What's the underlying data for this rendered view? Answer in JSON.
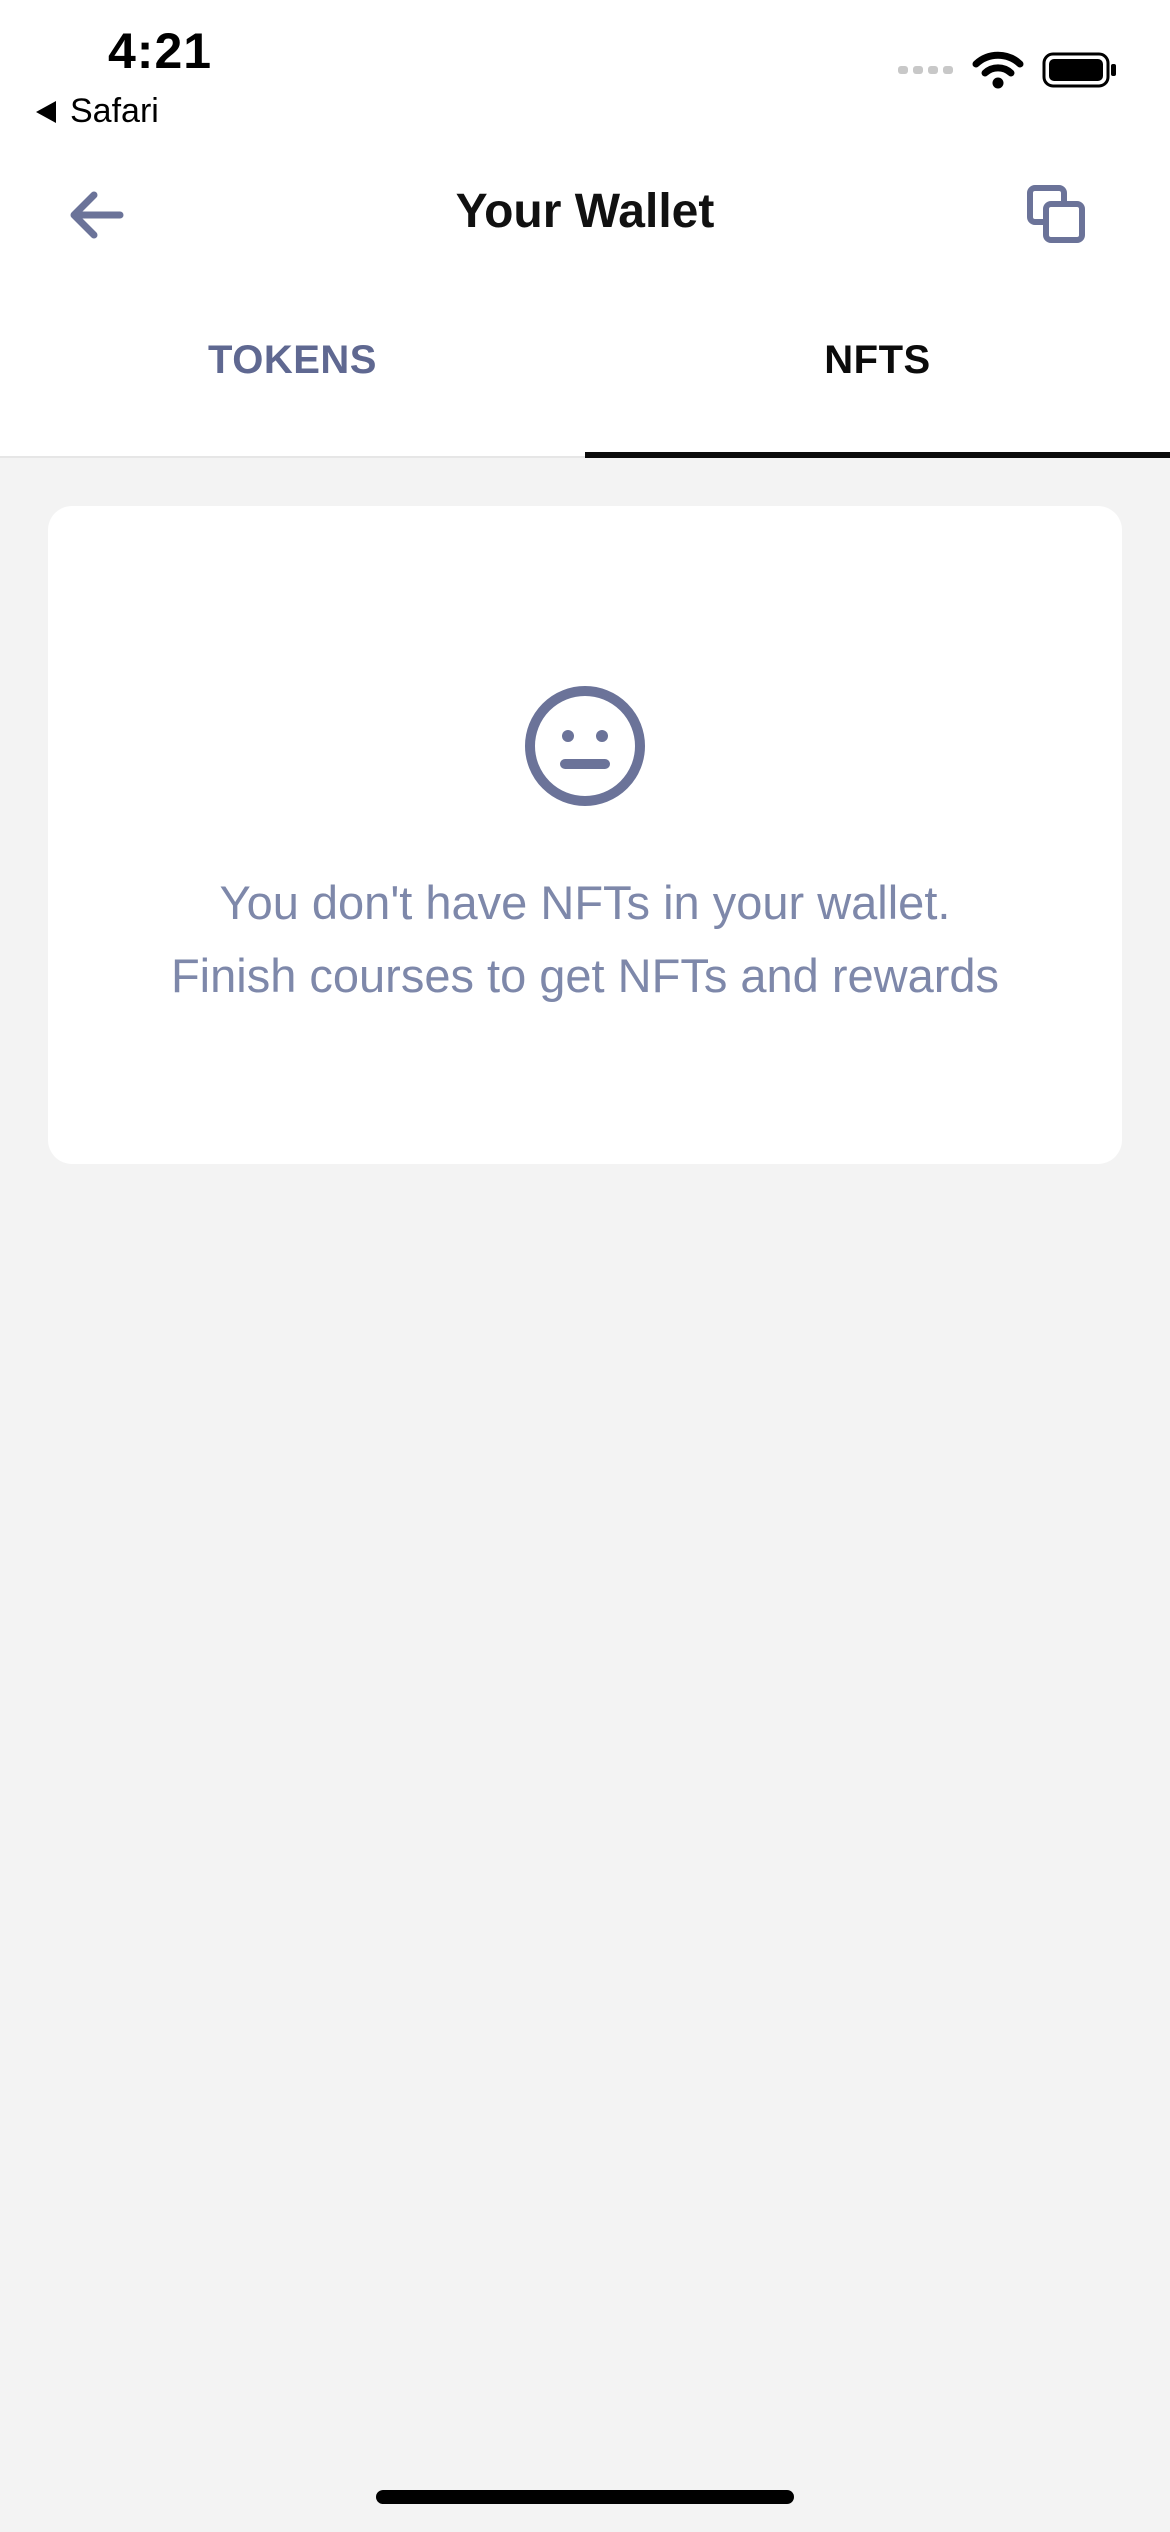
{
  "status_bar": {
    "time": "4:21",
    "back_app": "Safari",
    "icons": [
      "cellular-signal-icon",
      "wifi-icon",
      "battery-icon"
    ]
  },
  "header": {
    "title": "Your Wallet",
    "back_icon": "arrow-left-icon",
    "copy_icon": "copy-icon"
  },
  "tabs": [
    {
      "label": "TOKENS",
      "active": false
    },
    {
      "label": "NFTS",
      "active": true
    }
  ],
  "empty_state": {
    "icon": "neutral-face-icon",
    "line1": "You don't have NFTs in your wallet.",
    "line2": "Finish courses to get NFTs and rewards"
  },
  "colors": {
    "accent": "#6b7399",
    "muted_text": "#7e88aa",
    "inactive_tab": "#5f6891",
    "background": "#f3f3f3"
  }
}
